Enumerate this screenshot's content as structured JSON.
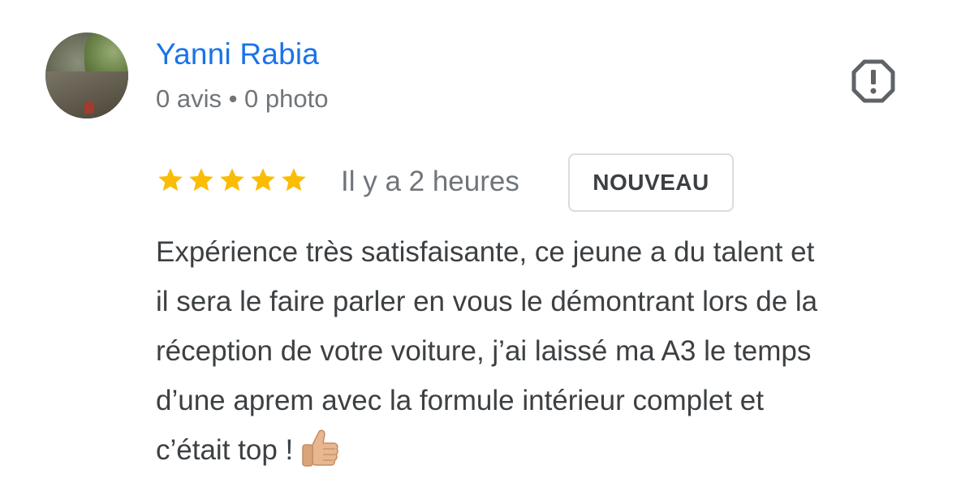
{
  "reviewer": {
    "name": "Yanni Rabia",
    "meta": "0 avis • 0 photo"
  },
  "report_icon": "report-flag-icon",
  "rating": {
    "stars": 5,
    "max": 5,
    "star_icon": "star-icon"
  },
  "time": "Il y a 2 heures",
  "badge": "NOUVEAU",
  "review_lines": [
    "Expérience très satisfaisante, ce jeune a du talent et",
    "il sera le faire parler en vous le démontrant lors de la",
    "réception de votre voiture, j’ai laissé ma A3 le temps",
    "d’une aprem avec la formule intérieur complet et",
    "c’était top !"
  ],
  "emoji": "thumbs-up-icon",
  "colors": {
    "name": "#1a73e8",
    "secondary_text": "#70757a",
    "body_text": "#3c4043",
    "star": "#fbbc04",
    "badge_border": "#dadce0"
  }
}
